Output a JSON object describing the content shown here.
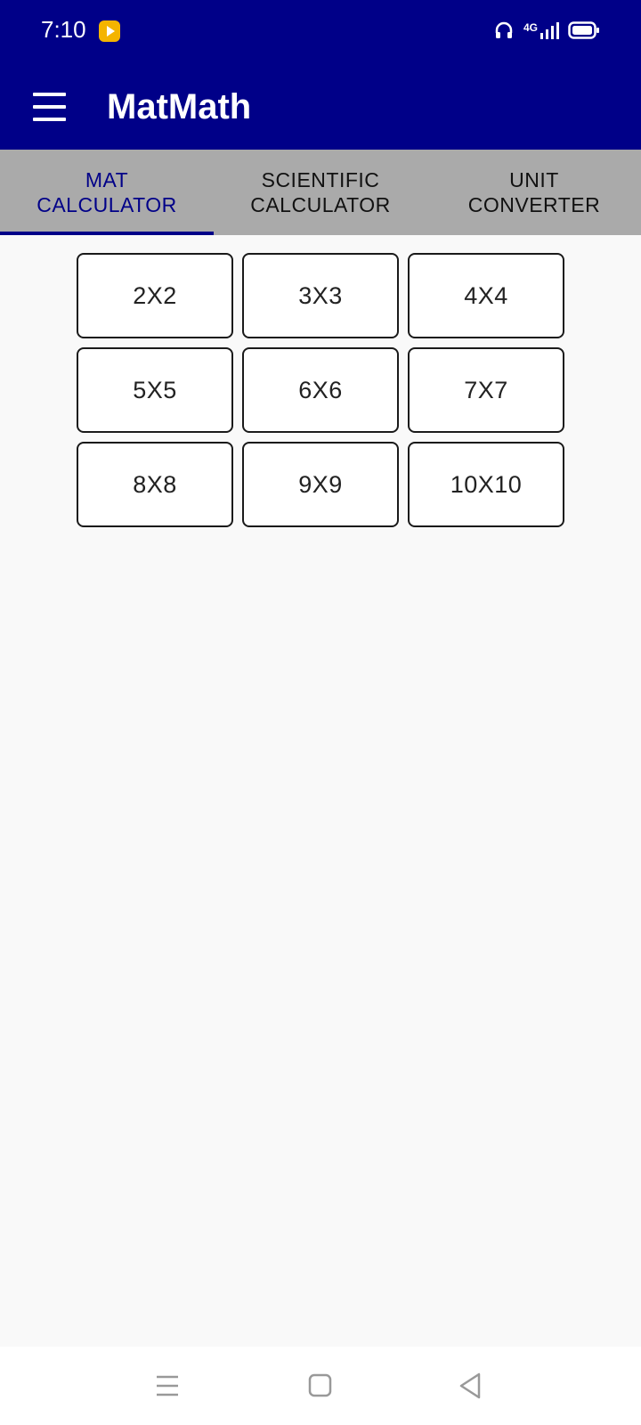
{
  "status_bar": {
    "time": "7:10",
    "network": "4G",
    "icons": [
      "app-notification-icon",
      "headset-icon",
      "signal-icon",
      "battery-icon"
    ]
  },
  "app_bar": {
    "title": "MatMath",
    "menu_icon": "hamburger-menu-icon"
  },
  "tabs": [
    {
      "label": "MAT\nCALCULATOR",
      "active": true
    },
    {
      "label": "SCIENTIFIC\nCALCULATOR",
      "active": false
    },
    {
      "label": "UNIT\nCONVERTER",
      "active": false
    }
  ],
  "matrix_sizes": [
    "2X2",
    "3X3",
    "4X4",
    "5X5",
    "6X6",
    "7X7",
    "8X8",
    "9X9",
    "10X10"
  ],
  "nav_bar": {
    "icons": [
      "recents-icon",
      "home-icon",
      "back-icon"
    ]
  },
  "colors": {
    "primary": "#000088",
    "tab_bar": "#aaaaaa",
    "background": "#f9f9f9",
    "notification_icon": "#f4b400"
  }
}
